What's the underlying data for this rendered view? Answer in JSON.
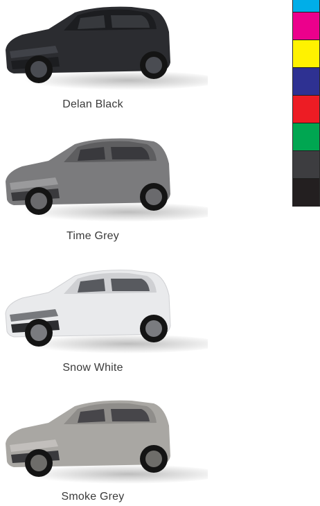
{
  "cars": [
    {
      "label": "Delan Black",
      "body": "#2b2c30",
      "roof": "#1c1d20",
      "light": "#4a4c52"
    },
    {
      "label": "Time Grey",
      "body": "#7b7b7d",
      "roof": "#5e5e60",
      "light": "#a2a2a4"
    },
    {
      "label": "Snow White",
      "body": "#e9eaec",
      "roof": "#cfd0d3",
      "light": "#ffffff"
    },
    {
      "label": "Smoke Grey",
      "body": "#a9a7a3",
      "roof": "#8f8d8a",
      "light": "#c8c6c2"
    }
  ],
  "swatches": [
    "#00aee8",
    "#ec008c",
    "#fff200",
    "#2e3192",
    "#ed1c24",
    "#00a651",
    "#3d3d40",
    "#231f20"
  ]
}
